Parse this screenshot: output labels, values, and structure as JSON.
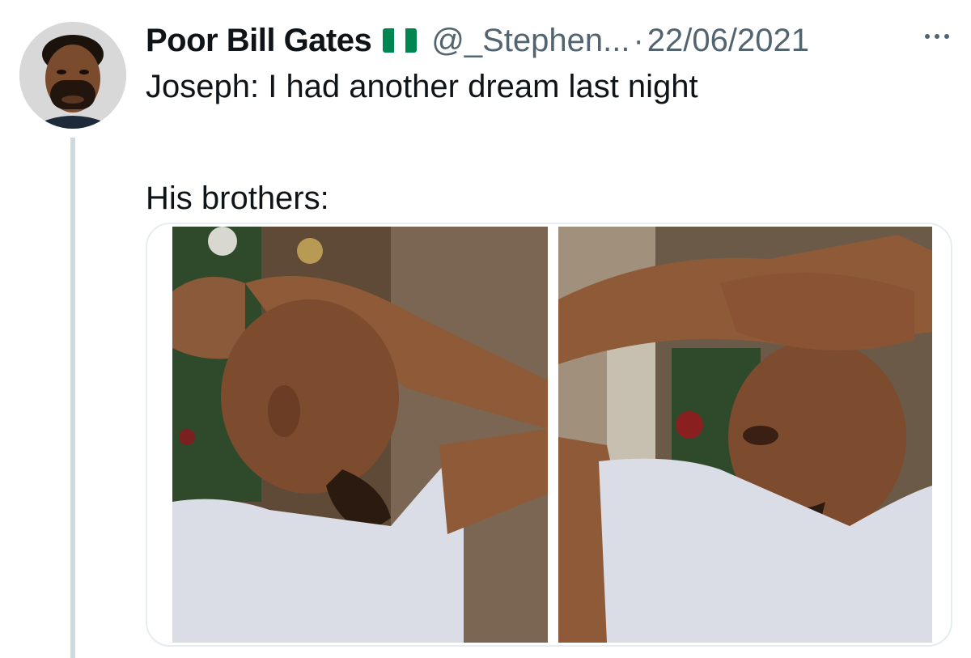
{
  "tweet": {
    "display_name": "Poor Bill Gates",
    "flag_icon": "nigeria-flag-icon",
    "handle": "@_Stephen...",
    "separator": "·",
    "date": "22/06/2021",
    "text_line1": "Joseph: I had another dream last night",
    "text_line2": "His brothers:"
  },
  "colors": {
    "text": "#0f1419",
    "secondary": "#536471",
    "flag_green": "#008751",
    "flag_white": "#ffffff",
    "thread_line": "#cfd9de"
  },
  "media": {
    "count": 2
  }
}
